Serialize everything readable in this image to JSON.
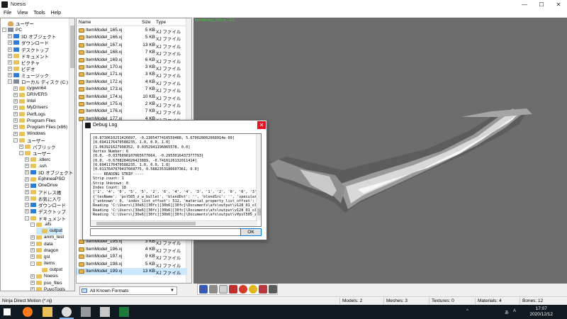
{
  "window": {
    "title": "Noesis"
  },
  "menu": [
    "File",
    "View",
    "Tools",
    "Help"
  ],
  "tree": [
    {
      "label": "ユーザー",
      "indent": 0,
      "exp": "",
      "icon": "user"
    },
    {
      "label": "PC",
      "indent": 0,
      "exp": "-",
      "icon": "drive"
    },
    {
      "label": "3D オブジェクト",
      "indent": 1,
      "exp": "+",
      "icon": "blue"
    },
    {
      "label": "ダウンロード",
      "indent": 1,
      "exp": "+",
      "icon": "blue"
    },
    {
      "label": "デスクトップ",
      "indent": 1,
      "exp": "+",
      "icon": "blue"
    },
    {
      "label": "ドキュメント",
      "indent": 1,
      "exp": "+",
      "icon": "fold"
    },
    {
      "label": "ピクチャ",
      "indent": 1,
      "exp": "+",
      "icon": "fold"
    },
    {
      "label": "ビデオ",
      "indent": 1,
      "exp": "+",
      "icon": "fold"
    },
    {
      "label": "ミュージック",
      "indent": 1,
      "exp": "+",
      "icon": "blue"
    },
    {
      "label": "ローカル ディスク (C:)",
      "indent": 1,
      "exp": "-",
      "icon": "drive"
    },
    {
      "label": "cygwin64",
      "indent": 2,
      "exp": "+",
      "icon": "fold"
    },
    {
      "label": "DRIVERS",
      "indent": 2,
      "exp": "+",
      "icon": "fold"
    },
    {
      "label": "Intel",
      "indent": 2,
      "exp": "+",
      "icon": "fold"
    },
    {
      "label": "MyDrivers",
      "indent": 2,
      "exp": "+",
      "icon": "fold"
    },
    {
      "label": "PerfLogs",
      "indent": 2,
      "exp": "+",
      "icon": "fold"
    },
    {
      "label": "Program Files",
      "indent": 2,
      "exp": "+",
      "icon": "fold"
    },
    {
      "label": "Program Files (x86)",
      "indent": 2,
      "exp": "+",
      "icon": "fold"
    },
    {
      "label": "Windows",
      "indent": 2,
      "exp": "+",
      "icon": "fold"
    },
    {
      "label": "ユーザー",
      "indent": 2,
      "exp": "-",
      "icon": "fold"
    },
    {
      "label": "パブリック",
      "indent": 3,
      "exp": "+",
      "icon": "fold"
    },
    {
      "label": "ユーザー",
      "indent": 3,
      "exp": "-",
      "icon": "fold"
    },
    {
      "label": ".idlerc",
      "indent": 4,
      "exp": "+",
      "icon": "fold"
    },
    {
      "label": ".ssh",
      "indent": 4,
      "exp": "+",
      "icon": "fold"
    },
    {
      "label": "3D オブジェクト",
      "indent": 4,
      "exp": "+",
      "icon": "blue"
    },
    {
      "label": "EphineaPSO",
      "indent": 4,
      "exp": "+",
      "icon": "fold"
    },
    {
      "label": "OneDrive",
      "indent": 4,
      "exp": "+",
      "icon": "blue"
    },
    {
      "label": "アドレス帳",
      "indent": 4,
      "exp": "+",
      "icon": "fold"
    },
    {
      "label": "お気に入り",
      "indent": 4,
      "exp": "+",
      "icon": "fold"
    },
    {
      "label": "ダウンロード",
      "indent": 4,
      "exp": "+",
      "icon": "blue"
    },
    {
      "label": "デスクトップ",
      "indent": 4,
      "exp": "+",
      "icon": "blue"
    },
    {
      "label": "ドキュメント",
      "indent": 4,
      "exp": "-",
      "icon": "fold"
    },
    {
      "label": ".afs",
      "indent": 5,
      "exp": "-",
      "icon": "fold"
    },
    {
      "label": "output",
      "indent": 6,
      "exp": "",
      "icon": "fold",
      "sel": true
    },
    {
      "label": "anim_test",
      "indent": 5,
      "exp": "+",
      "icon": "fold"
    },
    {
      "label": "data",
      "indent": 5,
      "exp": "+",
      "icon": "fold"
    },
    {
      "label": "dragon",
      "indent": 5,
      "exp": "+",
      "icon": "fold"
    },
    {
      "label": "gsl",
      "indent": 5,
      "exp": "+",
      "icon": "fold"
    },
    {
      "label": "items",
      "indent": 5,
      "exp": "-",
      "icon": "fold"
    },
    {
      "label": "output",
      "indent": 6,
      "exp": "",
      "icon": "fold"
    },
    {
      "label": "Noesis",
      "indent": 5,
      "exp": "+",
      "icon": "fold"
    },
    {
      "label": "pso_files",
      "indent": 5,
      "exp": "+",
      "icon": "fold"
    },
    {
      "label": "PuyoTools",
      "indent": 5,
      "exp": "+",
      "icon": "fold"
    }
  ],
  "filelist": {
    "headers": {
      "name": "Name",
      "size": "Size",
      "type": "Type"
    },
    "rows": [
      {
        "name": "ItemModel_165.xj",
        "size": "5 KB",
        "type": "XJ ファイル"
      },
      {
        "name": "ItemModel_166.xj",
        "size": "5 KB",
        "type": "XJ ファイル"
      },
      {
        "name": "ItemModel_167.xj",
        "size": "13 KB",
        "type": "XJ ファイル"
      },
      {
        "name": "ItemModel_168.xj",
        "size": "7 KB",
        "type": "XJ ファイル"
      },
      {
        "name": "ItemModel_169.xj",
        "size": "6 KB",
        "type": "XJ ファイル"
      },
      {
        "name": "ItemModel_170.xj",
        "size": "3 KB",
        "type": "XJ ファイル"
      },
      {
        "name": "ItemModel_171.xj",
        "size": "3 KB",
        "type": "XJ ファイル"
      },
      {
        "name": "ItemModel_172.xj",
        "size": "4 KB",
        "type": "XJ ファイル"
      },
      {
        "name": "ItemModel_173.xj",
        "size": "7 KB",
        "type": "XJ ファイル"
      },
      {
        "name": "ItemModel_174.xj",
        "size": "10 KB",
        "type": "XJ ファイル"
      },
      {
        "name": "ItemModel_175.xj",
        "size": "2 KB",
        "type": "XJ ファイル"
      },
      {
        "name": "ItemModel_176.xj",
        "size": "7 KB",
        "type": "XJ ファイル"
      },
      {
        "name": "ItemModel_177.xj",
        "size": "4 KB",
        "type": "XJ ファイル"
      }
    ],
    "bottom_rows": [
      {
        "name": "ItemModel_195.xj",
        "size": "3 KB",
        "type": "XJ ファイル"
      },
      {
        "name": "ItemModel_196.xj",
        "size": "4 KB",
        "type": "XJ ファイル"
      },
      {
        "name": "ItemModel_197.xj",
        "size": "9 KB",
        "type": "XJ ファイル"
      },
      {
        "name": "ItemModel_198.xj",
        "size": "5 KB",
        "type": "XJ ファイル"
      },
      {
        "name": "ItemModel_199.xj",
        "size": "13 KB",
        "type": "XJ ファイル",
        "sel": true
      }
    ]
  },
  "filter": {
    "label": "All Known Formats"
  },
  "viewport": {
    "label": "ItemModel_199.xj - 1/1",
    "bg": "#6d6d6d"
  },
  "dialog": {
    "title": "Debug Log",
    "ok_label": "OK",
    "lines": [
      "[0.8730610251426697, -0.2305477410559486, 5.670028002668914e-09]",
      "[0.6941176470588235, 1.0, 0.0, 1.0]",
      "[1.063921627998352, 0.0352941196865578, 0.0]",
      "Vertex Number: 6",
      "[0.0, -0.0376096107065677664, -0.2953016437377793]",
      "[0.0, -0.6708284020423889, -0.7416126132011414]",
      "[0.6941176470588235, 1.0, 0.0, 1.0]",
      "[0.0117647070437669775, 0.5882353186607361, 0.0]",
      "---- READING STRIP ----",
      "Strip count: 1",
      "Strip Unknown: 0",
      "Index Count: 18",
      "['1', '4', '0', '5', '5', '2', '6', '4', '4', '3', '1', '2', '0', '6', '3', '5']",
      "{'texName': 'pst505_z_w_bullet', 'blendDst': '', 'blendSrc': '', 'specular': [1.0, 1.0, 1.0, 1.0], 'ambi",
      "{'unknown': 0, 'index_list_offset': 512, 'material_property_list_offset': 448, 'index_count': 18, 'm",
      "Reading 'C:\\Users\\[30e6][30fc][30b6][30fc]\\Documents\\afs\\output\\v128_01_olser01'...Failed.",
      "Reading 'C:\\Users\\[30e6][30fc][30b6][30fc]\\Documents\\afs\\output\\v128_01_olser01'...Failed.",
      "Reading 'C:\\Users\\[30e6][30fc][30b6][30fc]\\Documents\\afs\\output\\v¥pst505_z_w_bullet'...Failed."
    ]
  },
  "status": {
    "left": "Ninja Direct Motion (*.nj)",
    "models": "Models: 2",
    "meshes": "Meshes: 3",
    "textures": "Textures: 0",
    "materials": "Materials: 4",
    "bones": "Bones: 12"
  },
  "taskbar": {
    "time": "17:07",
    "date": "2020/12/12",
    "lang": "あ",
    "ime": "A"
  }
}
